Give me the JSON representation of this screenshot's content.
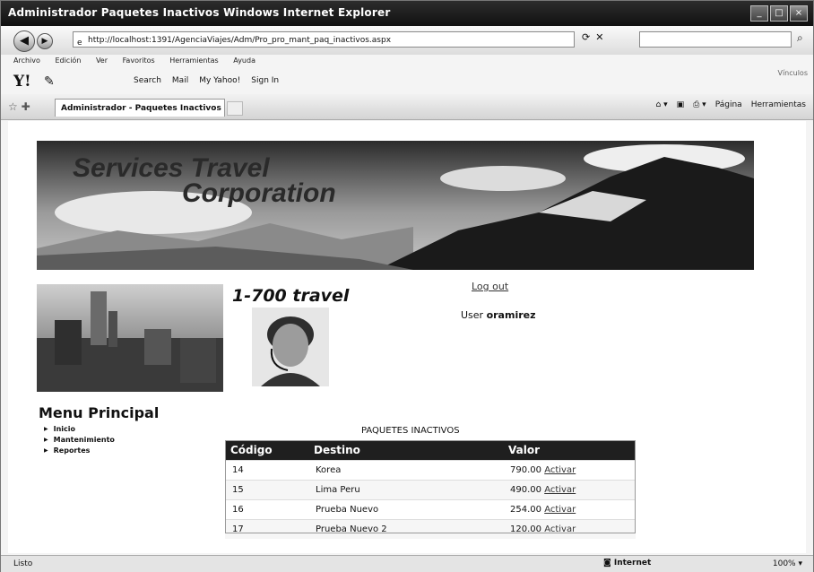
{
  "window": {
    "title": "Administrador  Paquetes Inactivos   Windows Internet Explorer"
  },
  "address": {
    "url": "http://localhost:1391/AgenciaViajes/Adm/Pro_pro_mant_paq_inactivos.aspx"
  },
  "menubar": {
    "items": [
      "Archivo",
      "Edición",
      "Ver",
      "Favoritos",
      "Herramientas",
      "Ayuda"
    ],
    "right": "Vínculos"
  },
  "yahoo": {
    "search": "Search",
    "mail": "Mail",
    "my_yahoo": "My Yahoo!",
    "signin": "Sign In"
  },
  "tab": {
    "label": "Administrador - Paquetes Inactivos"
  },
  "cmd": {
    "pagina": "Página",
    "herramientas": "Herramientas"
  },
  "banner": {
    "line1": "Services Travel",
    "line2": "Corporation"
  },
  "phone": "1-700 travel",
  "logout": "Log out",
  "user": {
    "label": "User",
    "name": "oramirez"
  },
  "menu": {
    "title": "Menu Principal",
    "items": [
      "Inicio",
      "Mantenimiento",
      "Reportes"
    ]
  },
  "packages": {
    "title": "PAQUETES INACTIVOS",
    "headers": [
      "Código",
      "Destino",
      "Valor"
    ],
    "rows": [
      {
        "code": "14",
        "destino": "Korea",
        "valor": "790.00",
        "action": "Activar"
      },
      {
        "code": "15",
        "destino": "Lima  Peru",
        "valor": "490.00",
        "action": "Activar"
      },
      {
        "code": "16",
        "destino": "Prueba  Nuevo",
        "valor": "254.00",
        "action": "Activar"
      },
      {
        "code": "17",
        "destino": "Prueba  Nuevo 2",
        "valor": "120.00",
        "action": "Activar"
      }
    ]
  },
  "status": {
    "left": "Listo",
    "zone": "Internet",
    "zoom": "100%"
  }
}
